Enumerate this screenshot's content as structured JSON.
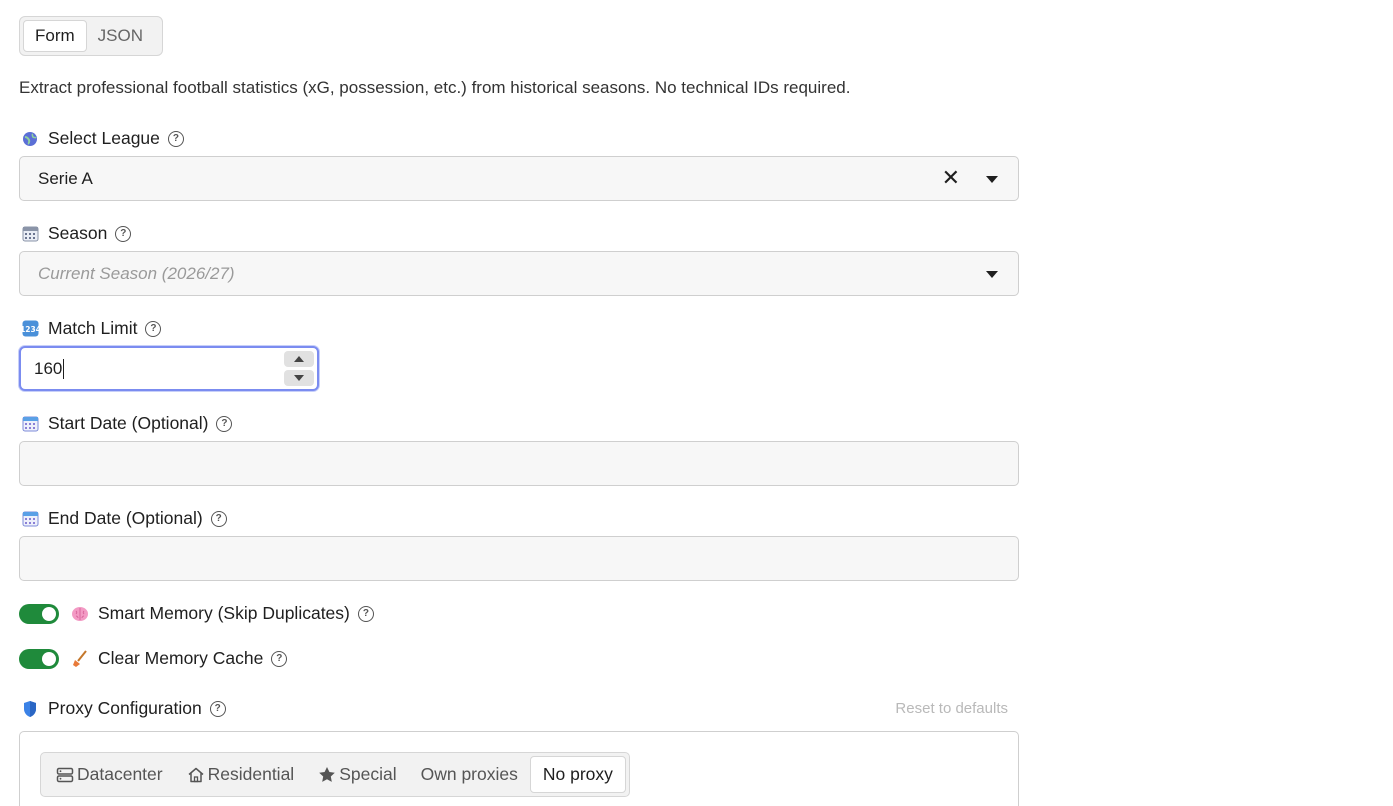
{
  "tabs": [
    "Form",
    "JSON"
  ],
  "active_tab": "Form",
  "description": "Extract professional football statistics (xG, possession, etc.) from historical seasons. No technical IDs required.",
  "fields": {
    "league": {
      "label": "Select League",
      "value": "Serie A",
      "icon": "globe-icon"
    },
    "season": {
      "label": "Season",
      "placeholder": "Current Season (2026/27)",
      "icon": "calendar-icon"
    },
    "match_limit": {
      "label": "Match Limit",
      "value": "160",
      "icon": "numbers-icon"
    },
    "start_date": {
      "label": "Start Date (Optional)",
      "value": "",
      "icon": "calendar-icon"
    },
    "end_date": {
      "label": "End Date (Optional)",
      "value": "",
      "icon": "calendar-icon"
    }
  },
  "toggles": {
    "smart_memory": {
      "label": "Smart Memory (Skip Duplicates)",
      "on": true,
      "icon": "brain-icon"
    },
    "clear_cache": {
      "label": "Clear Memory Cache",
      "on": true,
      "icon": "broom-icon"
    }
  },
  "proxy": {
    "label": "Proxy Configuration",
    "icon": "shield-icon",
    "reset_label": "Reset to defaults",
    "options": [
      "Datacenter",
      "Residential",
      "Special",
      "Own proxies",
      "No proxy"
    ],
    "selected": "No proxy"
  },
  "colors": {
    "toggle_on": "#1f8a3b",
    "focus_ring": "#7b8cf0"
  }
}
